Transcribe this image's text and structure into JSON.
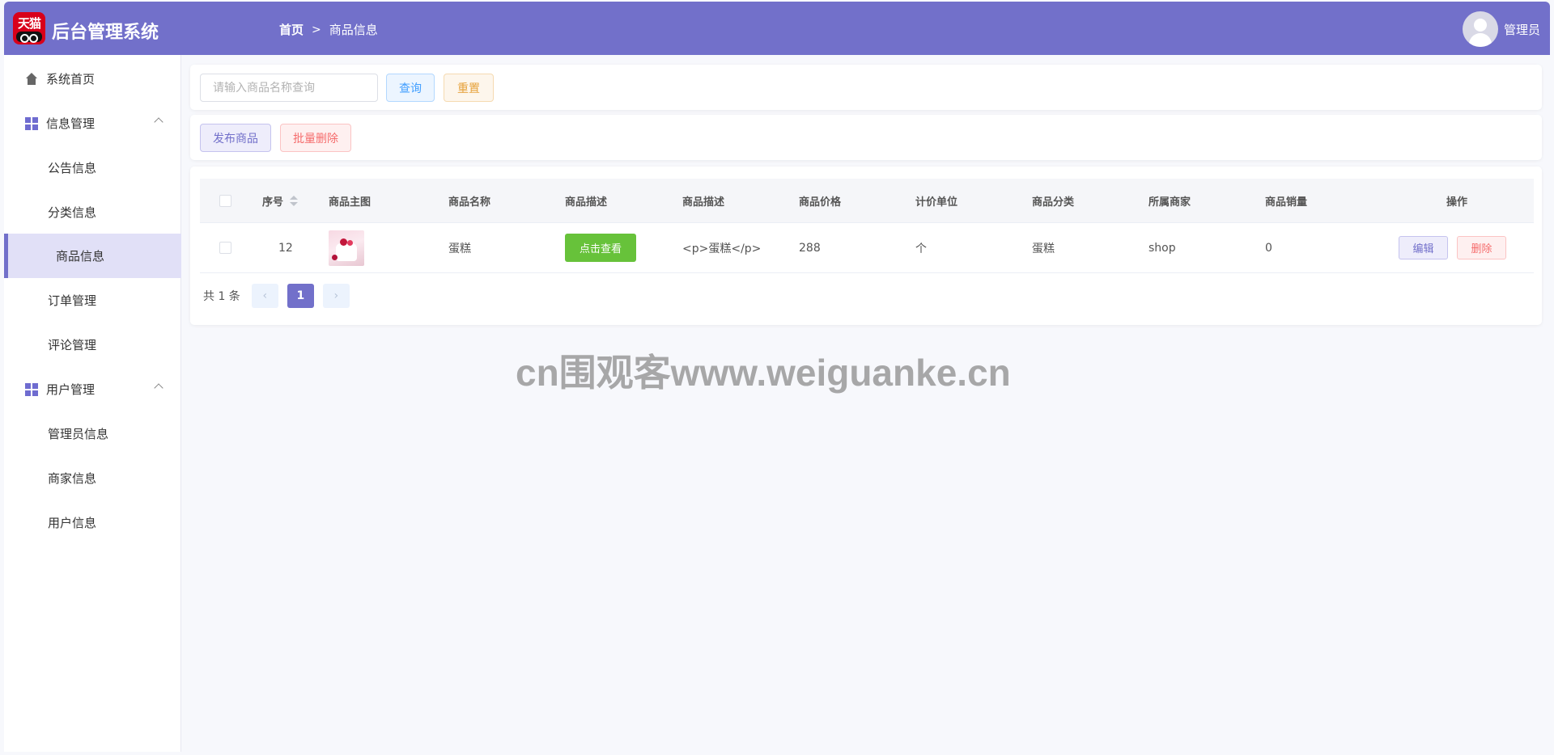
{
  "header": {
    "logo_text": "天猫",
    "app_title": "后台管理系统",
    "breadcrumb_home": "首页",
    "breadcrumb_sep": ">",
    "breadcrumb_current": "商品信息",
    "user_name": "管理员",
    "background_color": "#7270ca"
  },
  "sidebar": {
    "home": "系统首页",
    "group_info": "信息管理",
    "item_notice": "公告信息",
    "item_category": "分类信息",
    "item_goods": "商品信息",
    "item_orders": "订单管理",
    "item_comments": "评论管理",
    "group_users": "用户管理",
    "item_admins": "管理员信息",
    "item_merchants": "商家信息",
    "item_users": "用户信息",
    "active_item": "商品信息"
  },
  "search": {
    "placeholder": "请输入商品名称查询",
    "query_label": "查询",
    "reset_label": "重置"
  },
  "actions": {
    "publish_label": "发布商品",
    "batch_delete_label": "批量删除"
  },
  "table": {
    "headers": {
      "index": "序号",
      "image": "商品主图",
      "name": "商品名称",
      "desc_btn": "商品描述",
      "desc_text": "商品描述",
      "price": "商品价格",
      "unit": "计价单位",
      "category": "商品分类",
      "merchant": "所属商家",
      "sales": "商品销量",
      "ops": "操作"
    },
    "rows": [
      {
        "index": "12",
        "name": "蛋糕",
        "view_label": "点击查看",
        "desc_text": "<p>蛋糕</p>",
        "price": "288",
        "unit": "个",
        "category": "蛋糕",
        "merchant": "shop",
        "sales": "0",
        "edit_label": "编辑",
        "delete_label": "删除"
      }
    ]
  },
  "pagination": {
    "total_text": "共 1 条",
    "prev_icon": "‹",
    "current_page": "1",
    "next_icon": "›"
  },
  "watermark": "cn围观客www.weiguanke.cn"
}
